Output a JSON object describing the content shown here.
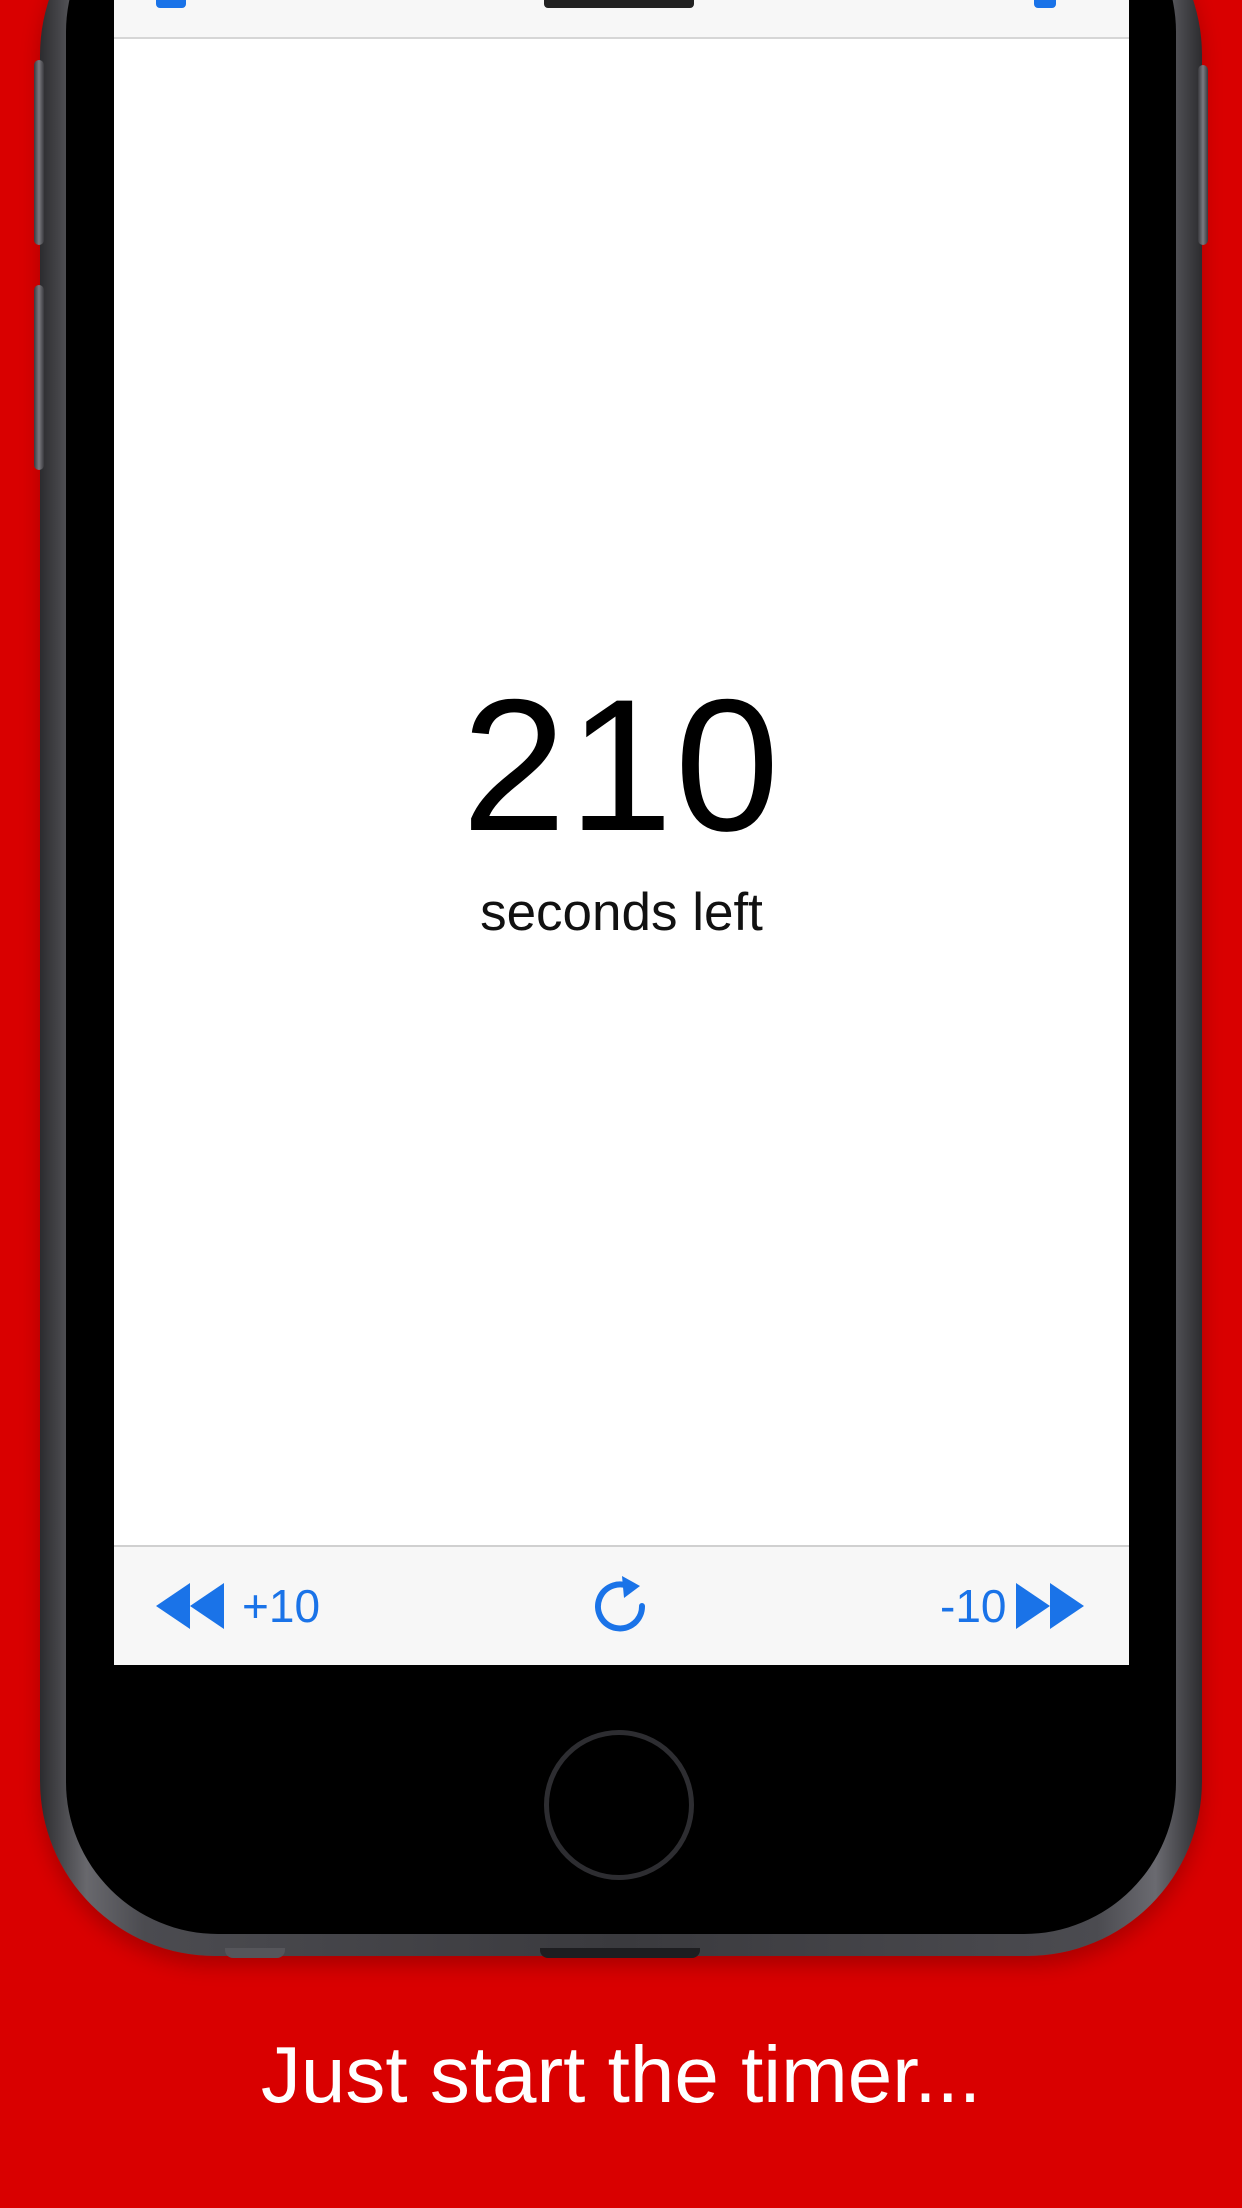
{
  "timer": {
    "value": "210",
    "label": "seconds left"
  },
  "toolbar": {
    "add_label": "+10",
    "add_icon": "rewind-icon",
    "reset_icon": "refresh-icon",
    "subtract_label": "-10",
    "subtract_icon": "fast-forward-icon"
  },
  "caption": "Just start the timer...",
  "colors": {
    "background": "#d90000",
    "accent": "#1a73e8",
    "text": "#000000",
    "caption_text": "#ffffff"
  }
}
